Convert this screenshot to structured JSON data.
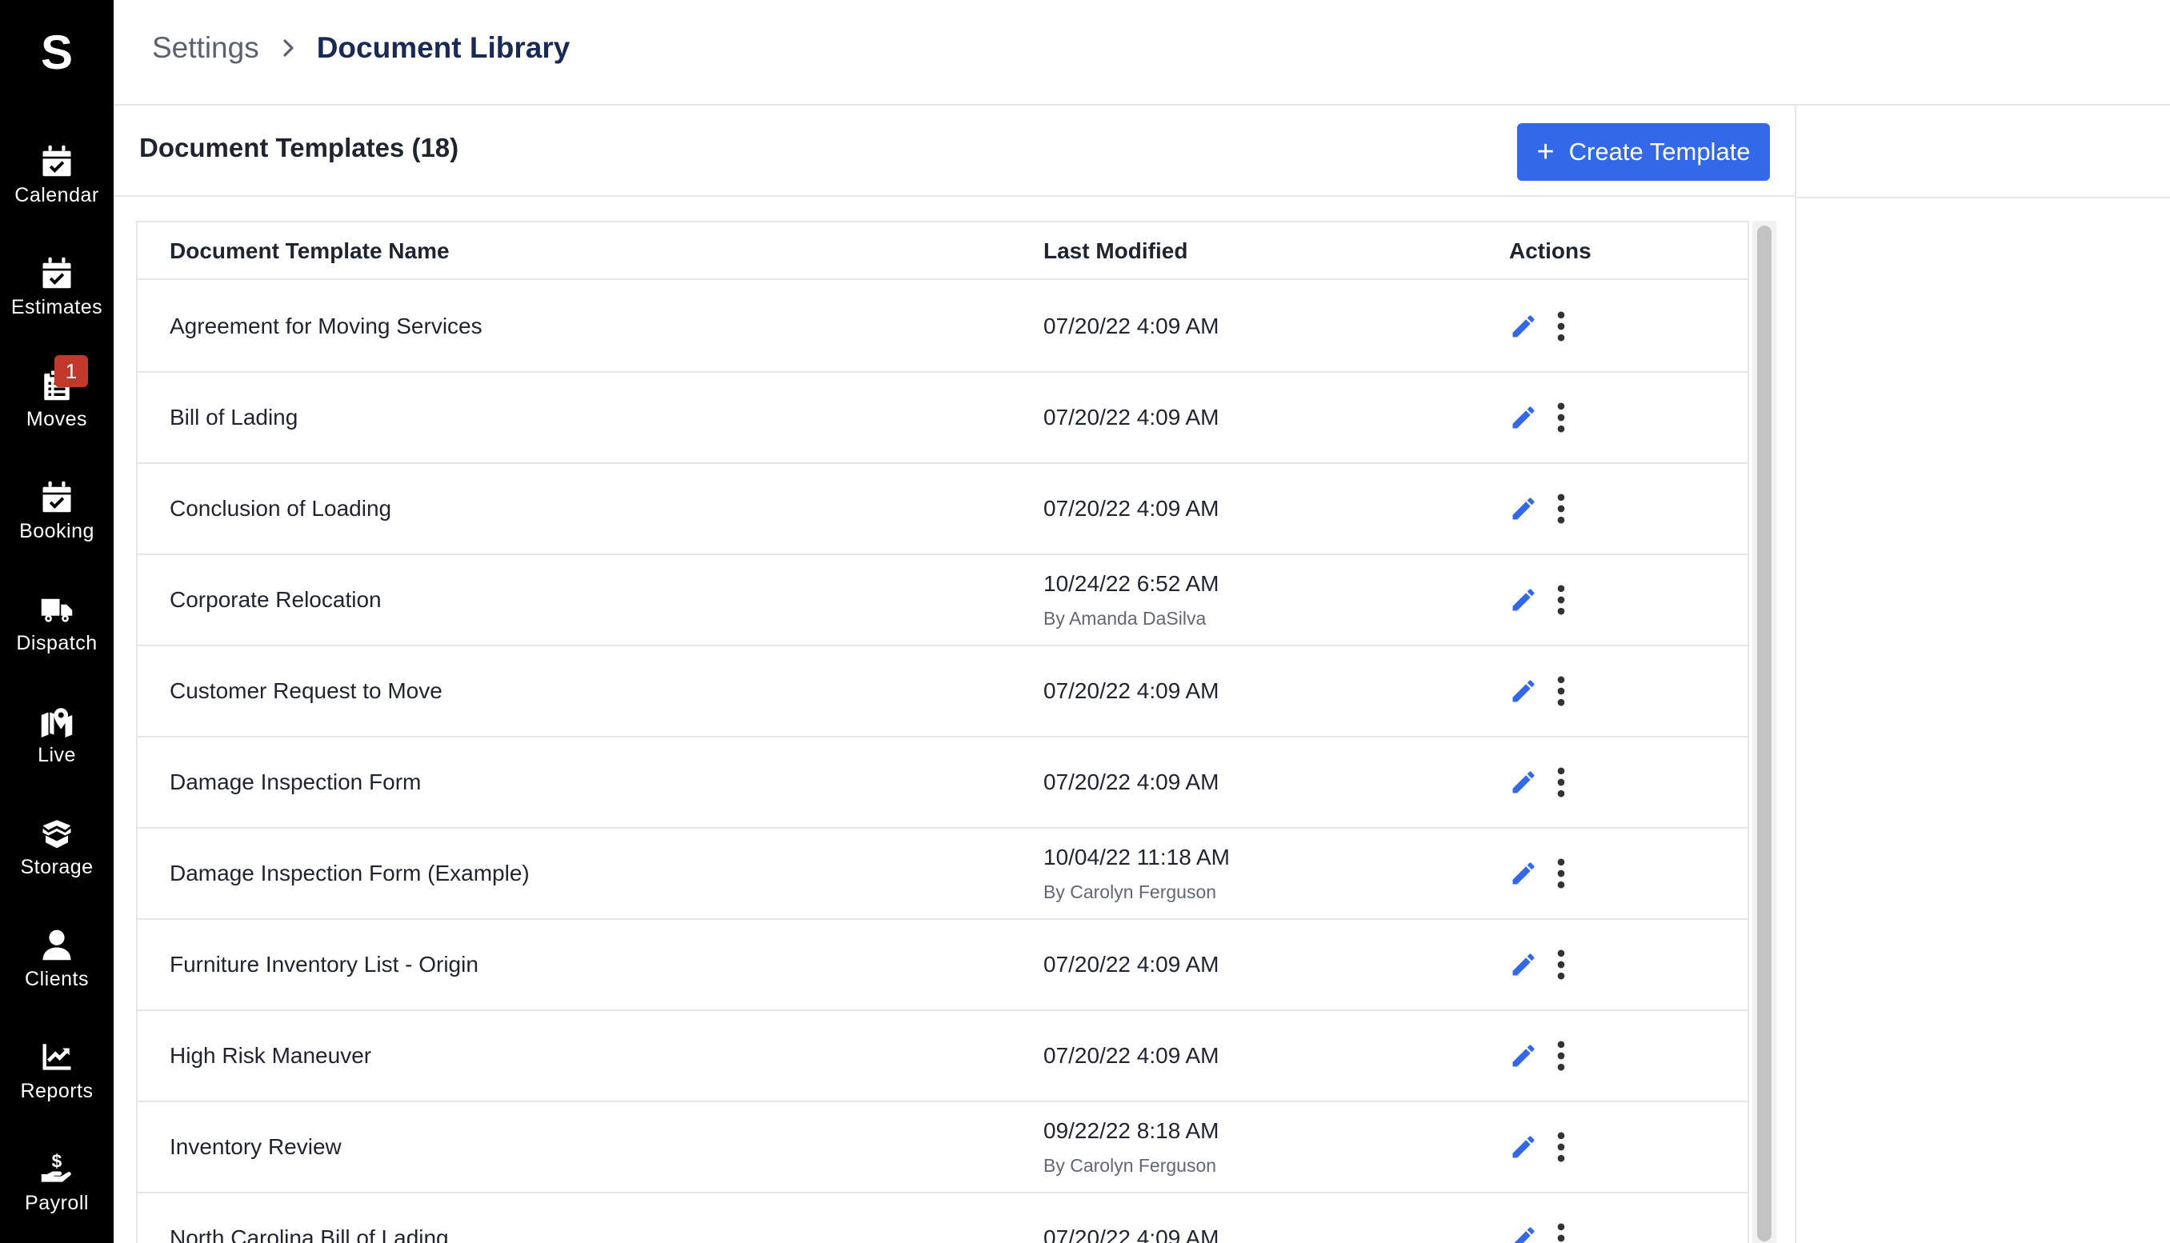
{
  "app": {
    "logo": "S"
  },
  "sidebar": {
    "items": [
      {
        "label": "Calendar",
        "icon": "calendar-check-icon"
      },
      {
        "label": "Estimates",
        "icon": "calendar-check-icon"
      },
      {
        "label": "Moves",
        "icon": "clipboard-list-icon",
        "badge": "1"
      },
      {
        "label": "Booking",
        "icon": "calendar-check-icon"
      },
      {
        "label": "Dispatch",
        "icon": "truck-icon"
      },
      {
        "label": "Live",
        "icon": "map-marker-icon"
      },
      {
        "label": "Storage",
        "icon": "box-open-icon"
      },
      {
        "label": "Clients",
        "icon": "user-icon"
      },
      {
        "label": "Reports",
        "icon": "chart-line-icon"
      },
      {
        "label": "Payroll",
        "icon": "hand-dollar-icon"
      }
    ]
  },
  "breadcrumb": {
    "parent": "Settings",
    "current": "Document Library"
  },
  "panel": {
    "title": "Document Templates (18)",
    "create_button": "Create Template",
    "create_icon": "+"
  },
  "table": {
    "columns": {
      "name": "Document Template Name",
      "modified": "Last Modified",
      "actions": "Actions"
    },
    "rows": [
      {
        "name": "Agreement for Moving Services",
        "date": "07/20/22 4:09 AM",
        "by": ""
      },
      {
        "name": "Bill of Lading",
        "date": "07/20/22 4:09 AM",
        "by": ""
      },
      {
        "name": "Conclusion of Loading",
        "date": "07/20/22 4:09 AM",
        "by": ""
      },
      {
        "name": "Corporate Relocation",
        "date": "10/24/22 6:52 AM",
        "by": "By Amanda DaSilva"
      },
      {
        "name": "Customer Request to Move",
        "date": "07/20/22 4:09 AM",
        "by": ""
      },
      {
        "name": "Damage Inspection Form",
        "date": "07/20/22 4:09 AM",
        "by": ""
      },
      {
        "name": "Damage Inspection Form (Example)",
        "date": "10/04/22 11:18 AM",
        "by": "By Carolyn Ferguson"
      },
      {
        "name": "Furniture Inventory List - Origin",
        "date": "07/20/22 4:09 AM",
        "by": ""
      },
      {
        "name": "High Risk Maneuver",
        "date": "07/20/22 4:09 AM",
        "by": ""
      },
      {
        "name": "Inventory Review",
        "date": "09/22/22 8:18 AM",
        "by": "By Carolyn Ferguson"
      },
      {
        "name": "North Carolina Bill of Lading",
        "date": "07/20/22 4:09 AM",
        "by": ""
      }
    ]
  },
  "colors": {
    "sidebar_bg": "#000000",
    "accent": "#3368e8",
    "badge": "#c0392b",
    "breadcrumb_current": "#182a55"
  }
}
